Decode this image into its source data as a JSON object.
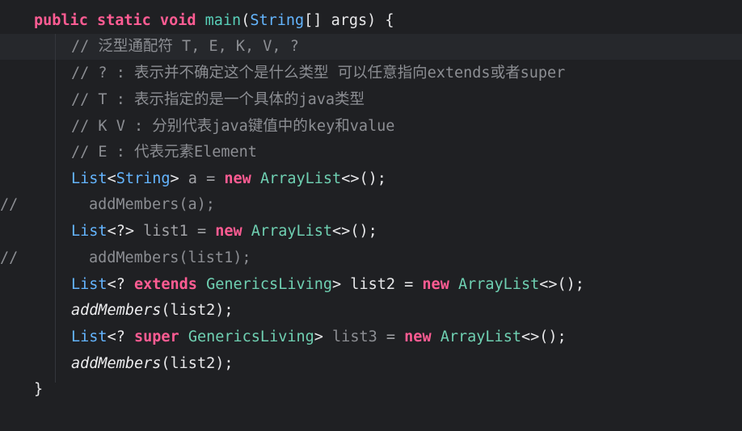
{
  "code": {
    "sig": {
      "kw": "public static void",
      "fn": "main",
      "type": "String",
      "rest": "[] args) {"
    },
    "comments": [
      "// 泛型通配符 T, E, K, V, ?",
      "// ? : 表示并不确定这个是什么类型 可以任意指向extends或者super",
      "// T : 表示指定的是一个具体的java类型",
      "// K V : 分别代表java键值中的key和value",
      "// E : 代表元素Element"
    ],
    "l6": {
      "type": "List",
      "lt": "<",
      "gen": "String",
      "gt": ">",
      "var": " a = ",
      "kw": "new",
      "cls": "ArrayList",
      "rest": "<>();"
    },
    "l7": {
      "mark": "//",
      "text": "addMembers(a);"
    },
    "l8": {
      "type": "List",
      "gen": "<?>",
      "var": " list1 = ",
      "kw": "new",
      "cls": "ArrayList",
      "rest": "<>();"
    },
    "l9": {
      "mark": "//",
      "text": "addMembers(list1);"
    },
    "l10": {
      "type": "List",
      "pre": "<? ",
      "kw1": "extends",
      "cls1": "GenericsLiving",
      "mid": "> list2 = ",
      "kw2": "new",
      "cls2": "ArrayList",
      "rest": "<>();"
    },
    "l11": {
      "fn": "addMembers",
      "rest": "(list2);"
    },
    "l12": {
      "type": "List",
      "pre": "<? ",
      "kw1": "super",
      "cls1": "GenericsLiving",
      "mid": "> ",
      "var": "list3",
      "eq": " = ",
      "kw2": "new",
      "cls2": "ArrayList",
      "rest": "<>();"
    },
    "l13": {
      "fn": "addMembers",
      "rest": "(list2);"
    },
    "close": "}"
  }
}
